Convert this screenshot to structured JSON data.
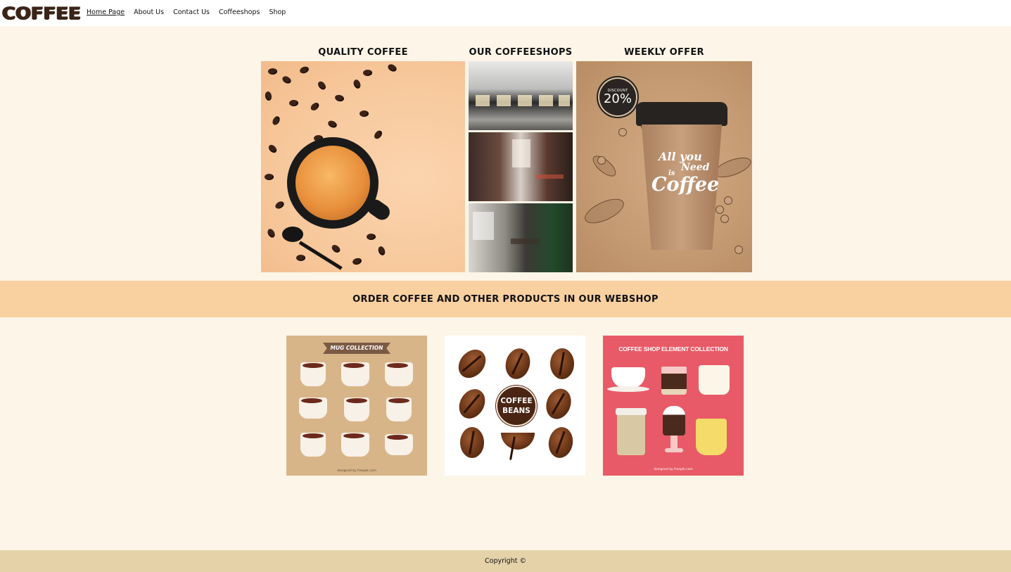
{
  "logo": "COFFEE",
  "nav": {
    "items": [
      "Home Page",
      "About Us",
      "Contact Us",
      "Coffeeshops",
      "Shop"
    ],
    "active": "Home Page"
  },
  "features": {
    "quality_title": "QUALITY COFFEE",
    "shops_title": "OUR COFFEESHOPS",
    "offer_title": "WEEKLY OFFER",
    "offer_badge_label": "DISCOUNT",
    "offer_badge_value": "20%",
    "offer_line1": "All you",
    "offer_line2": "Need",
    "offer_line3": "is",
    "offer_line4": "Coffee"
  },
  "banner": {
    "title": "ORDER COFFEE AND OTHER PRODUCTS IN OUR WEBSHOP"
  },
  "products": {
    "mugs_ribbon": "MUG COLLECTION",
    "mugs_credit": "designed by freepik.com",
    "beans_line1": "COFFEE",
    "beans_line2": "BEANS",
    "shop_title": "COFFEE SHOP ELEMENT COLLECTION",
    "shop_credit": "designed by freepik.com"
  },
  "footer": {
    "copyright": "Copyright ©"
  },
  "colors": {
    "page_bg": "#fdf5e8",
    "banner_bg": "#f9d0a0",
    "footer_bg": "#e6d2a9",
    "mugs_bg": "#d8b588",
    "shop_bg": "#e85a67"
  }
}
